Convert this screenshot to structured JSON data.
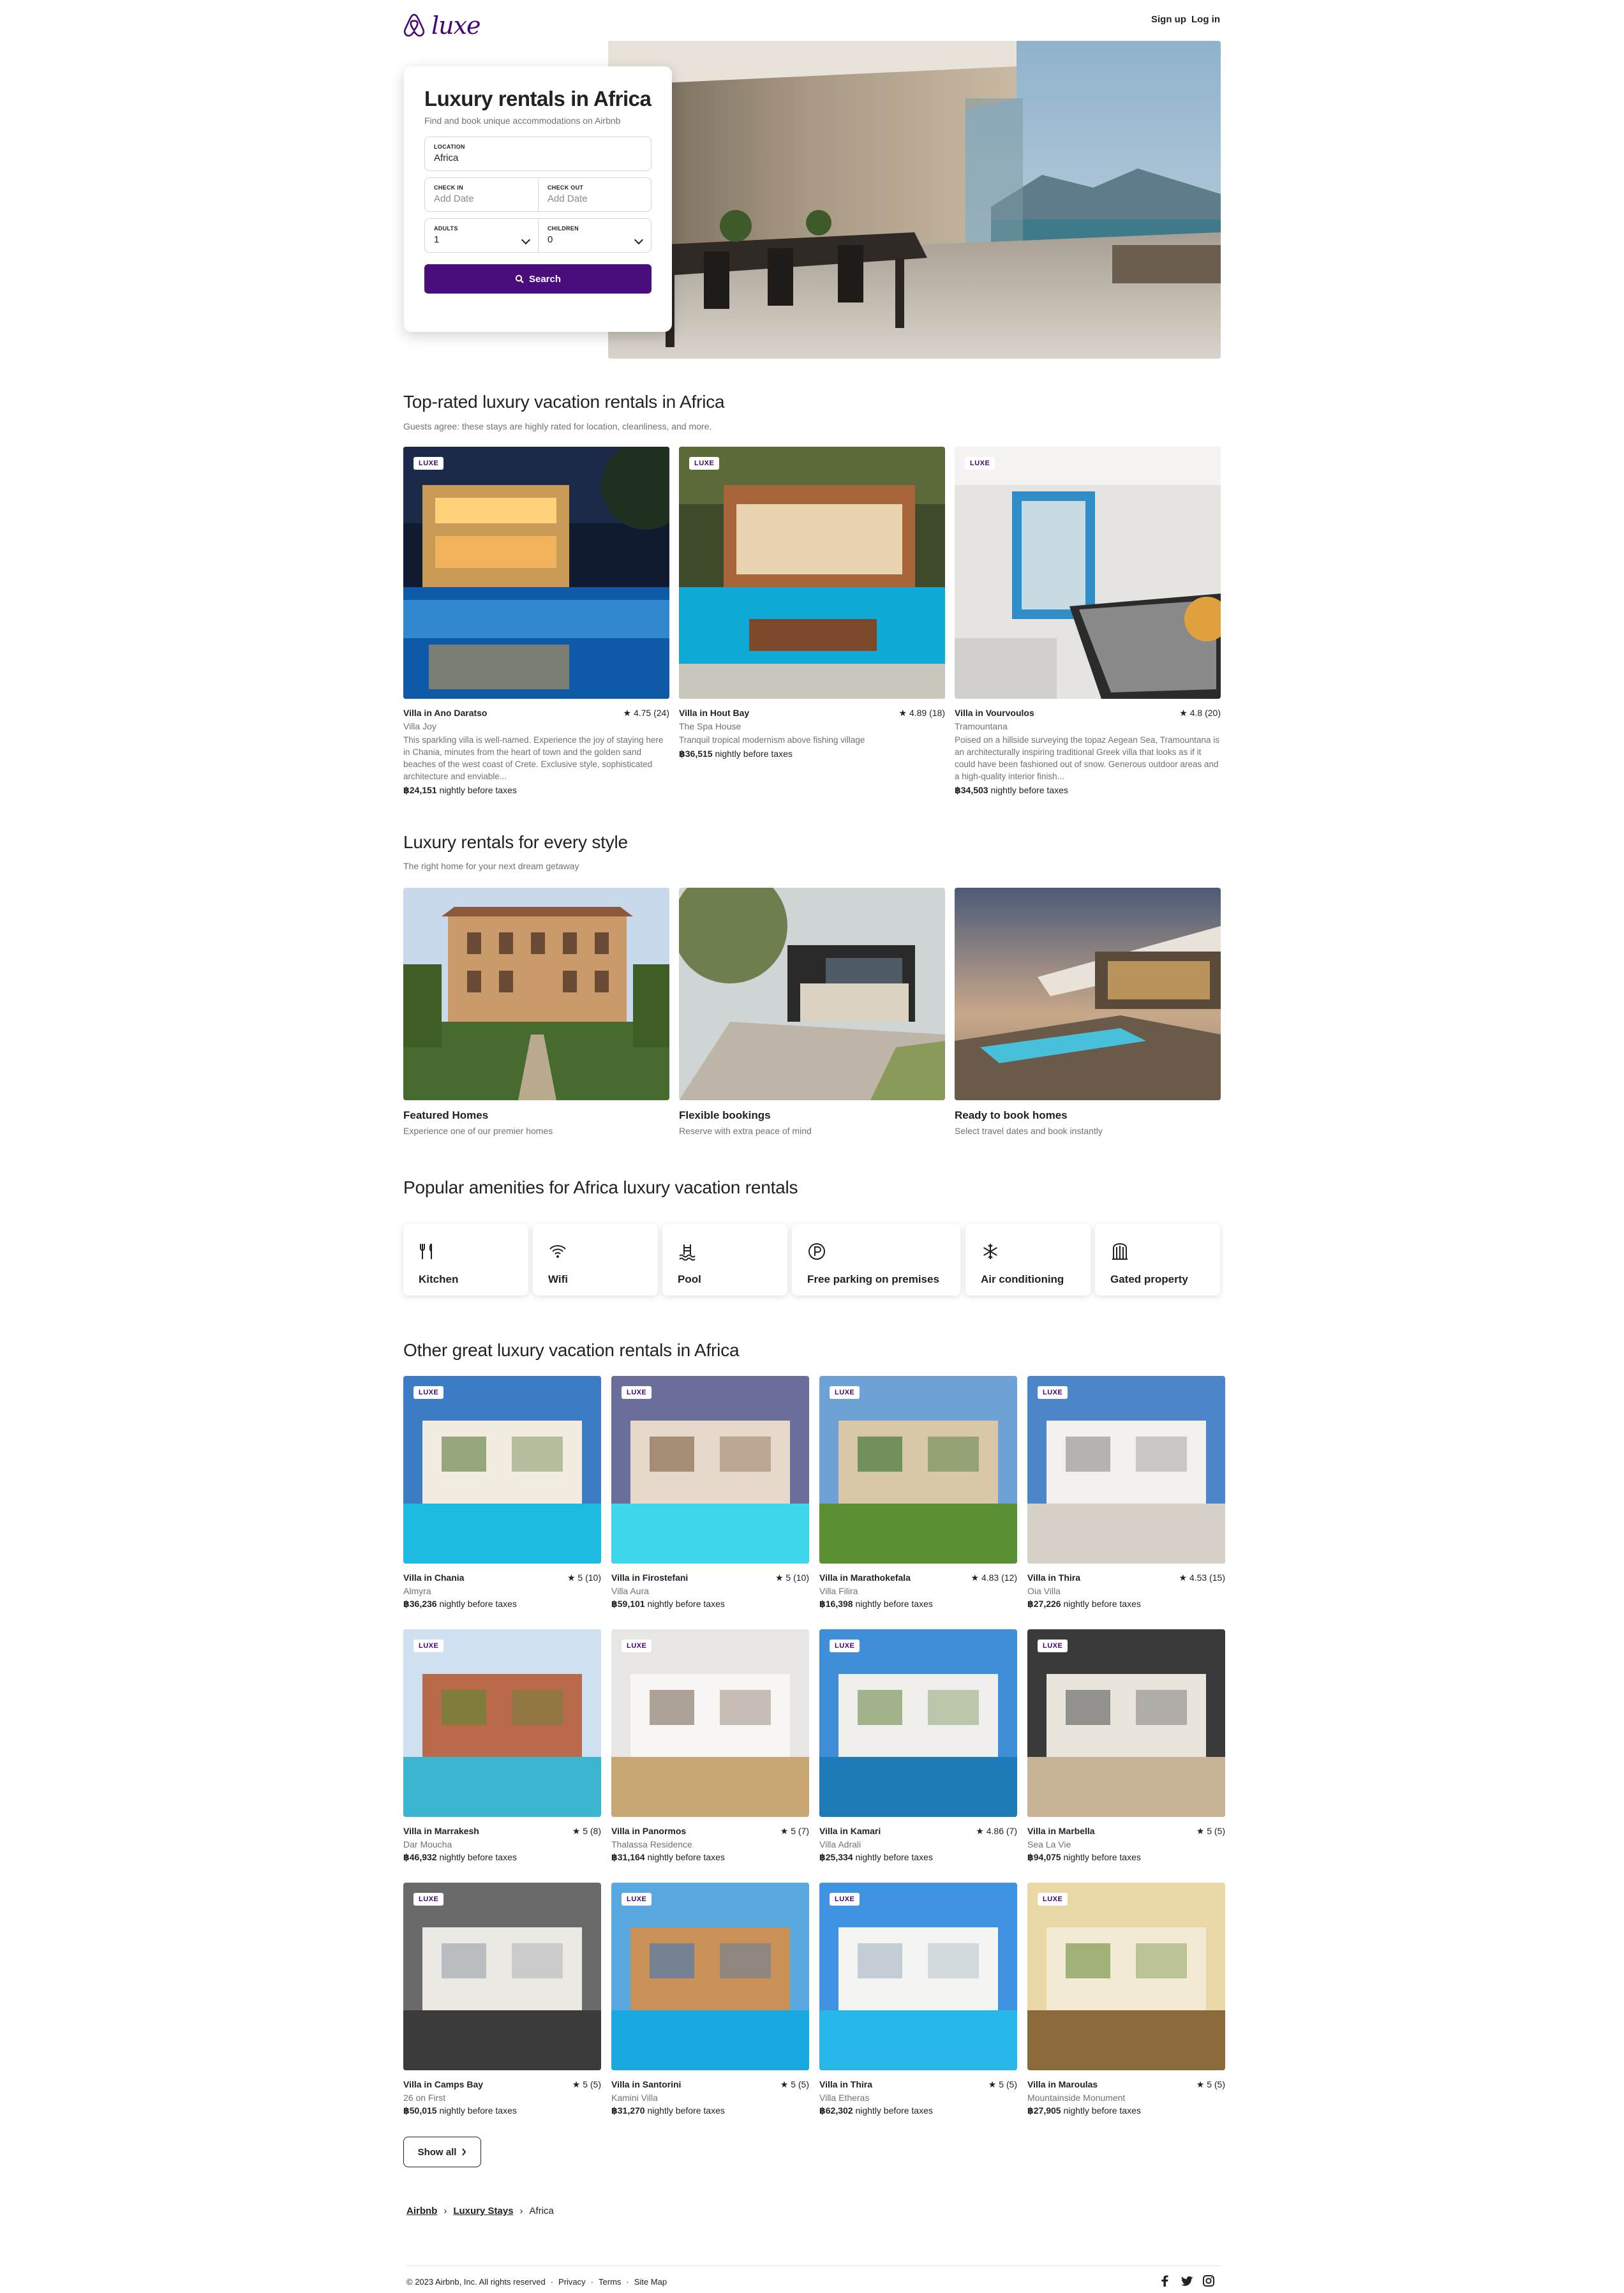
{
  "header": {
    "logo_text": "luxe",
    "sign_up": "Sign up",
    "log_in": "Log in"
  },
  "search": {
    "title": "Luxury rentals in Africa",
    "subtitle": "Find and book unique accommodations on Airbnb",
    "location_label": "LOCATION",
    "location_value": "Africa",
    "checkin_label": "CHECK IN",
    "checkin_placeholder": "Add Date",
    "checkout_label": "CHECK OUT",
    "checkout_placeholder": "Add Date",
    "adults_label": "ADULTS",
    "adults_value": "1",
    "children_label": "CHILDREN",
    "children_value": "0",
    "button": "Search"
  },
  "top_rated": {
    "title": "Top-rated luxury vacation rentals in Africa",
    "subtitle": "Guests agree: these stays are highly rated for location, cleanliness, and more.",
    "badge": "LUXE",
    "items": [
      {
        "location": "Villa in Ano Daratso",
        "rating": "★ 4.75 (24)",
        "name": "Villa Joy",
        "desc": "This sparkling villa is well-named. Experience the joy of staying here in Chania, minutes from the heart of town and the golden sand beaches of the west coast of Crete. Exclusive style, sophisticated architecture and enviable...",
        "price": "฿24,151",
        "price_suffix": " nightly before taxes"
      },
      {
        "location": "Villa in Hout Bay",
        "rating": "★ 4.89 (18)",
        "name": "The Spa House",
        "desc": "Tranquil tropical modernism above fishing village",
        "price": "฿36,515",
        "price_suffix": " nightly before taxes"
      },
      {
        "location": "Villa in Vourvoulos",
        "rating": "★ 4.8 (20)",
        "name": "Tramountana",
        "desc": "Poised on a hillside surveying the topaz Aegean Sea, Tramountana is an architecturally inspiring traditional Greek villa that looks as if it could have been fashioned out of snow. Generous outdoor areas and a high-quality interior finish...",
        "price": "฿34,503",
        "price_suffix": " nightly before taxes"
      }
    ]
  },
  "styles": {
    "title": "Luxury rentals for every style",
    "subtitle": "The right home for your next dream getaway",
    "items": [
      {
        "title": "Featured Homes",
        "sub": "Experience one of our premier homes"
      },
      {
        "title": "Flexible bookings",
        "sub": "Reserve with extra peace of mind"
      },
      {
        "title": "Ready to book homes",
        "sub": "Select travel dates and book instantly"
      }
    ]
  },
  "amenities": {
    "title": "Popular amenities for Africa luxury vacation rentals",
    "items": [
      {
        "label": "Kitchen",
        "icon": "kitchen-icon"
      },
      {
        "label": "Wifi",
        "icon": "wifi-icon"
      },
      {
        "label": "Pool",
        "icon": "pool-icon"
      },
      {
        "label": "Free parking on premises",
        "icon": "parking-icon"
      },
      {
        "label": "Air conditioning",
        "icon": "snowflake-icon"
      },
      {
        "label": "Gated property",
        "icon": "gate-icon"
      }
    ]
  },
  "other": {
    "title": "Other great luxury vacation rentals in Africa",
    "items": [
      {
        "location": "Villa in Chania",
        "rating": "★ 5 (10)",
        "name": "Almyra",
        "price": "฿36,236",
        "price_suffix": " nightly before taxes"
      },
      {
        "location": "Villa in Firostefani",
        "rating": "★ 5 (10)",
        "name": "Villa Aura",
        "price": "฿59,101",
        "price_suffix": " nightly before taxes"
      },
      {
        "location": "Villa in Marathokefala",
        "rating": "★ 4.83 (12)",
        "name": "Villa Filira",
        "price": "฿16,398",
        "price_suffix": " nightly before taxes"
      },
      {
        "location": "Villa in Thira",
        "rating": "★ 4.53 (15)",
        "name": "Oia Villa",
        "price": "฿27,226",
        "price_suffix": " nightly before taxes"
      },
      {
        "location": "Villa in Marrakesh",
        "rating": "★ 5 (8)",
        "name": "Dar Moucha",
        "price": "฿46,932",
        "price_suffix": " nightly before taxes"
      },
      {
        "location": "Villa in Panormos",
        "rating": "★ 5 (7)",
        "name": "Thalassa Residence",
        "price": "฿31,164",
        "price_suffix": " nightly before taxes"
      },
      {
        "location": "Villa in Kamari",
        "rating": "★ 4.86 (7)",
        "name": "Villa Adrali",
        "price": "฿25,334",
        "price_suffix": " nightly before taxes"
      },
      {
        "location": "Villa in Marbella",
        "rating": "★ 5 (5)",
        "name": "Sea La Vie",
        "price": "฿94,075",
        "price_suffix": " nightly before taxes"
      },
      {
        "location": "Villa in Camps Bay",
        "rating": "★ 5 (5)",
        "name": "26 on First",
        "price": "฿50,015",
        "price_suffix": " nightly before taxes"
      },
      {
        "location": "Villa in Santorini",
        "rating": "★ 5 (5)",
        "name": "Kamini Villa",
        "price": "฿31,270",
        "price_suffix": " nightly before taxes"
      },
      {
        "location": "Villa in Thira",
        "rating": "★ 5 (5)",
        "name": "Villa Etheras",
        "price": "฿62,302",
        "price_suffix": " nightly before taxes"
      },
      {
        "location": "Villa in Maroulas",
        "rating": "★ 5 (5)",
        "name": "Mountainside Monument",
        "price": "฿27,905",
        "price_suffix": " nightly before taxes"
      }
    ],
    "show_all": "Show all"
  },
  "breadcrumb": {
    "items": [
      "Airbnb",
      "Luxury Stays",
      "Africa"
    ],
    "sep": "›"
  },
  "footer": {
    "copyright": "© 2023 Airbnb, Inc. All rights reserved",
    "links": [
      "Privacy",
      "Terms",
      "Site Map"
    ],
    "dot": "·",
    "social": [
      "facebook-icon",
      "twitter-icon",
      "instagram-icon"
    ]
  },
  "colors": {
    "brand": "#460479",
    "button": "#4a0d7c",
    "muted_text": "#717171"
  }
}
